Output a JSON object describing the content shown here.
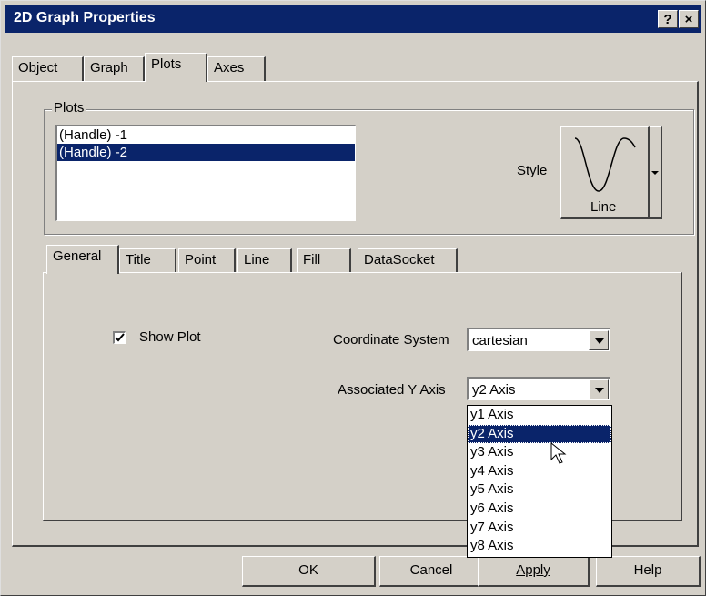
{
  "window": {
    "title": "2D Graph Properties",
    "help_button": "?",
    "close_button": "×"
  },
  "top_tabs": [
    {
      "label": "Object"
    },
    {
      "label": "Graph"
    },
    {
      "label": "Plots"
    },
    {
      "label": "Axes"
    }
  ],
  "plots_group": {
    "label": "Plots",
    "items": [
      {
        "label": "(Handle) -1",
        "selected": false
      },
      {
        "label": "(Handle) -2",
        "selected": true
      }
    ],
    "style_label": "Style",
    "style_value": "Line",
    "style_icon": "sine-wave-icon"
  },
  "sub_tabs": [
    {
      "label": "General"
    },
    {
      "label": "Title"
    },
    {
      "label": "Point"
    },
    {
      "label": "Line"
    },
    {
      "label": "Fill"
    },
    {
      "label": "DataSocket"
    }
  ],
  "general": {
    "show_plot_label": "Show Plot",
    "show_plot_checked": true,
    "coordinate_system_label": "Coordinate System",
    "coordinate_system_value": "cartesian",
    "associated_y_axis_label": "Associated Y Axis",
    "associated_y_axis_value": "y2 Axis",
    "y_axis_options": [
      "y1 Axis",
      "y2 Axis",
      "y3 Axis",
      "y4 Axis",
      "y5 Axis",
      "y6 Axis",
      "y7 Axis",
      "y8 Axis"
    ],
    "y_axis_highlighted": "y2 Axis"
  },
  "buttons": {
    "ok": "OK",
    "cancel": "Cancel",
    "apply": "Apply",
    "help": "Help"
  },
  "colors": {
    "titlebar": "#0a246a",
    "selection": "#0a246a",
    "face": "#d4d0c8"
  }
}
